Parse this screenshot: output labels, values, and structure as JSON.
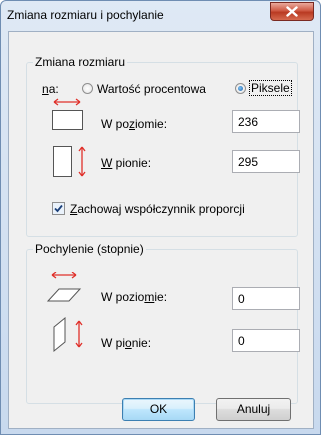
{
  "window": {
    "title": "Zmiana rozmiaru i pochylanie"
  },
  "resize": {
    "group_label": "Zmiana rozmiaru",
    "by_label_mnemonic": "n",
    "by_label_rest": "a:",
    "option_percent": "Wartość procentowa",
    "option_pixels": "Piksele",
    "selected": "Piksele",
    "horizontal_label_pre": "W po",
    "horizontal_label_mnemonic": "z",
    "horizontal_label_post": "iomie:",
    "horizontal_value": "236",
    "vertical_label_mnemonic": "W",
    "vertical_label_post": " pionie:",
    "vertical_value": "295",
    "keep_ratio_pre": "",
    "keep_ratio_mnemonic": "Z",
    "keep_ratio_post": "achowaj współczynnik proporcji",
    "keep_ratio_checked": true
  },
  "skew": {
    "group_label": "Pochylenie (stopnie)",
    "horizontal_label_pre": "W pozio",
    "horizontal_label_mnemonic": "m",
    "horizontal_label_post": "ie:",
    "horizontal_value": "0",
    "vertical_label_pre": "W pi",
    "vertical_label_mnemonic": "o",
    "vertical_label_post": "nie:",
    "vertical_value": "0"
  },
  "buttons": {
    "ok": "OK",
    "cancel": "Anuluj"
  },
  "colors": {
    "arrow": "#e0302a",
    "accent": "#3c7fb1"
  },
  "icons": {
    "resize_horizontal": "resize-horizontal-icon",
    "resize_vertical": "resize-vertical-icon",
    "skew_horizontal": "skew-horizontal-icon",
    "skew_vertical": "skew-vertical-icon"
  }
}
